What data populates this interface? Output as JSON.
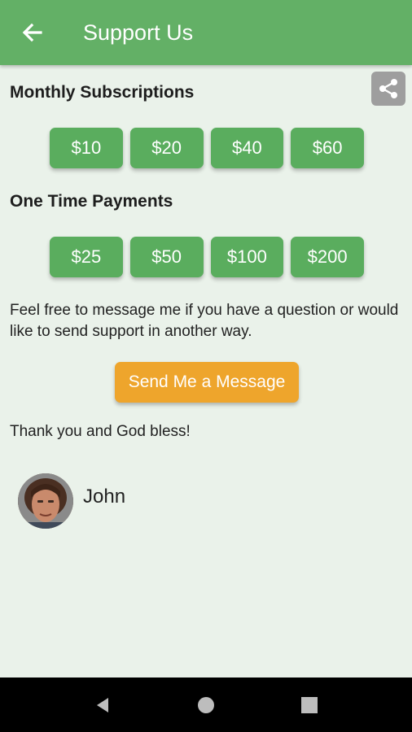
{
  "appbar": {
    "title": "Support Us",
    "back_icon": "arrow-left-icon"
  },
  "share_icon": "share-icon",
  "sections": {
    "monthly": {
      "title": "Monthly Subscriptions",
      "amounts": [
        "$10",
        "$20",
        "$40",
        "$60"
      ]
    },
    "onetime": {
      "title": "One Time Payments",
      "amounts": [
        "$25",
        "$50",
        "$100",
        "$200"
      ]
    }
  },
  "message_text": "Feel free to message me if you have a question or would like to send support in another way.",
  "send_button_label": "Send Me a Message",
  "thanks_text": "Thank you and God bless!",
  "author": {
    "name": "John"
  },
  "colors": {
    "appbar": "#63b066",
    "amount_button": "#5aad5e",
    "send_button": "#eea52c",
    "background": "#eaf2ea"
  },
  "navbar": {
    "icons": [
      "back-triangle-icon",
      "home-circle-icon",
      "recents-square-icon"
    ]
  }
}
